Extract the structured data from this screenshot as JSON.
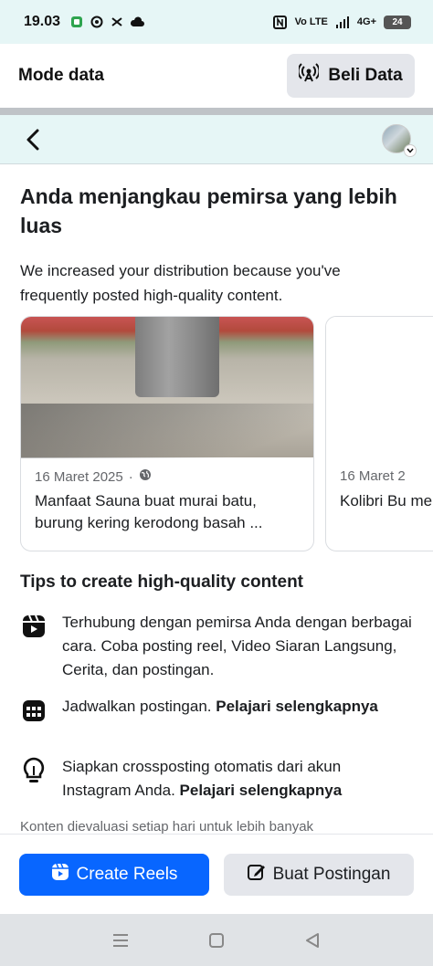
{
  "status_bar": {
    "time": "19.03",
    "network_label": "Vo LTE",
    "signal_label": "4G+",
    "battery_level": "24"
  },
  "data_mode": {
    "title": "Mode data",
    "buy_button_label": "Beli Data"
  },
  "headline": "Anda menjangkau pemirsa yang lebih luas",
  "subtext": "We increased your distribution because you've frequently posted high-quality content.",
  "cards": [
    {
      "date": "16 Maret 2025",
      "separator": "·",
      "title": "Manfaat Sauna buat murai batu, burung kering kerodong basah ..."
    },
    {
      "date": "16 Maret 2",
      "title": "Kolibri Bu meniruka"
    }
  ],
  "tips": {
    "title": "Tips to create high-quality content",
    "items": [
      {
        "icon": "reel-icon",
        "text": "Terhubung dengan pemirsa Anda dengan berbagai cara. Coba posting reel, Video Siaran Langsung, Cerita, dan postingan.",
        "link": ""
      },
      {
        "icon": "calendar-icon",
        "text": "Jadwalkan postingan. ",
        "link": "Pelajari selengkapnya"
      },
      {
        "icon": "lightbulb-icon",
        "text": "Siapkan crossposting otomatis dari akun Instagram Anda. ",
        "link": "Pelajari selengkapnya"
      }
    ]
  },
  "footnote": "Konten dievaluasi setiap hari untuk lebih banyak",
  "actions": {
    "create_reels_label": "Create Reels",
    "create_post_label": "Buat Postingan"
  },
  "colors": {
    "primary": "#0866ff",
    "secondary_bg": "#e4e6eb",
    "header_bg": "#e6f6f6"
  }
}
